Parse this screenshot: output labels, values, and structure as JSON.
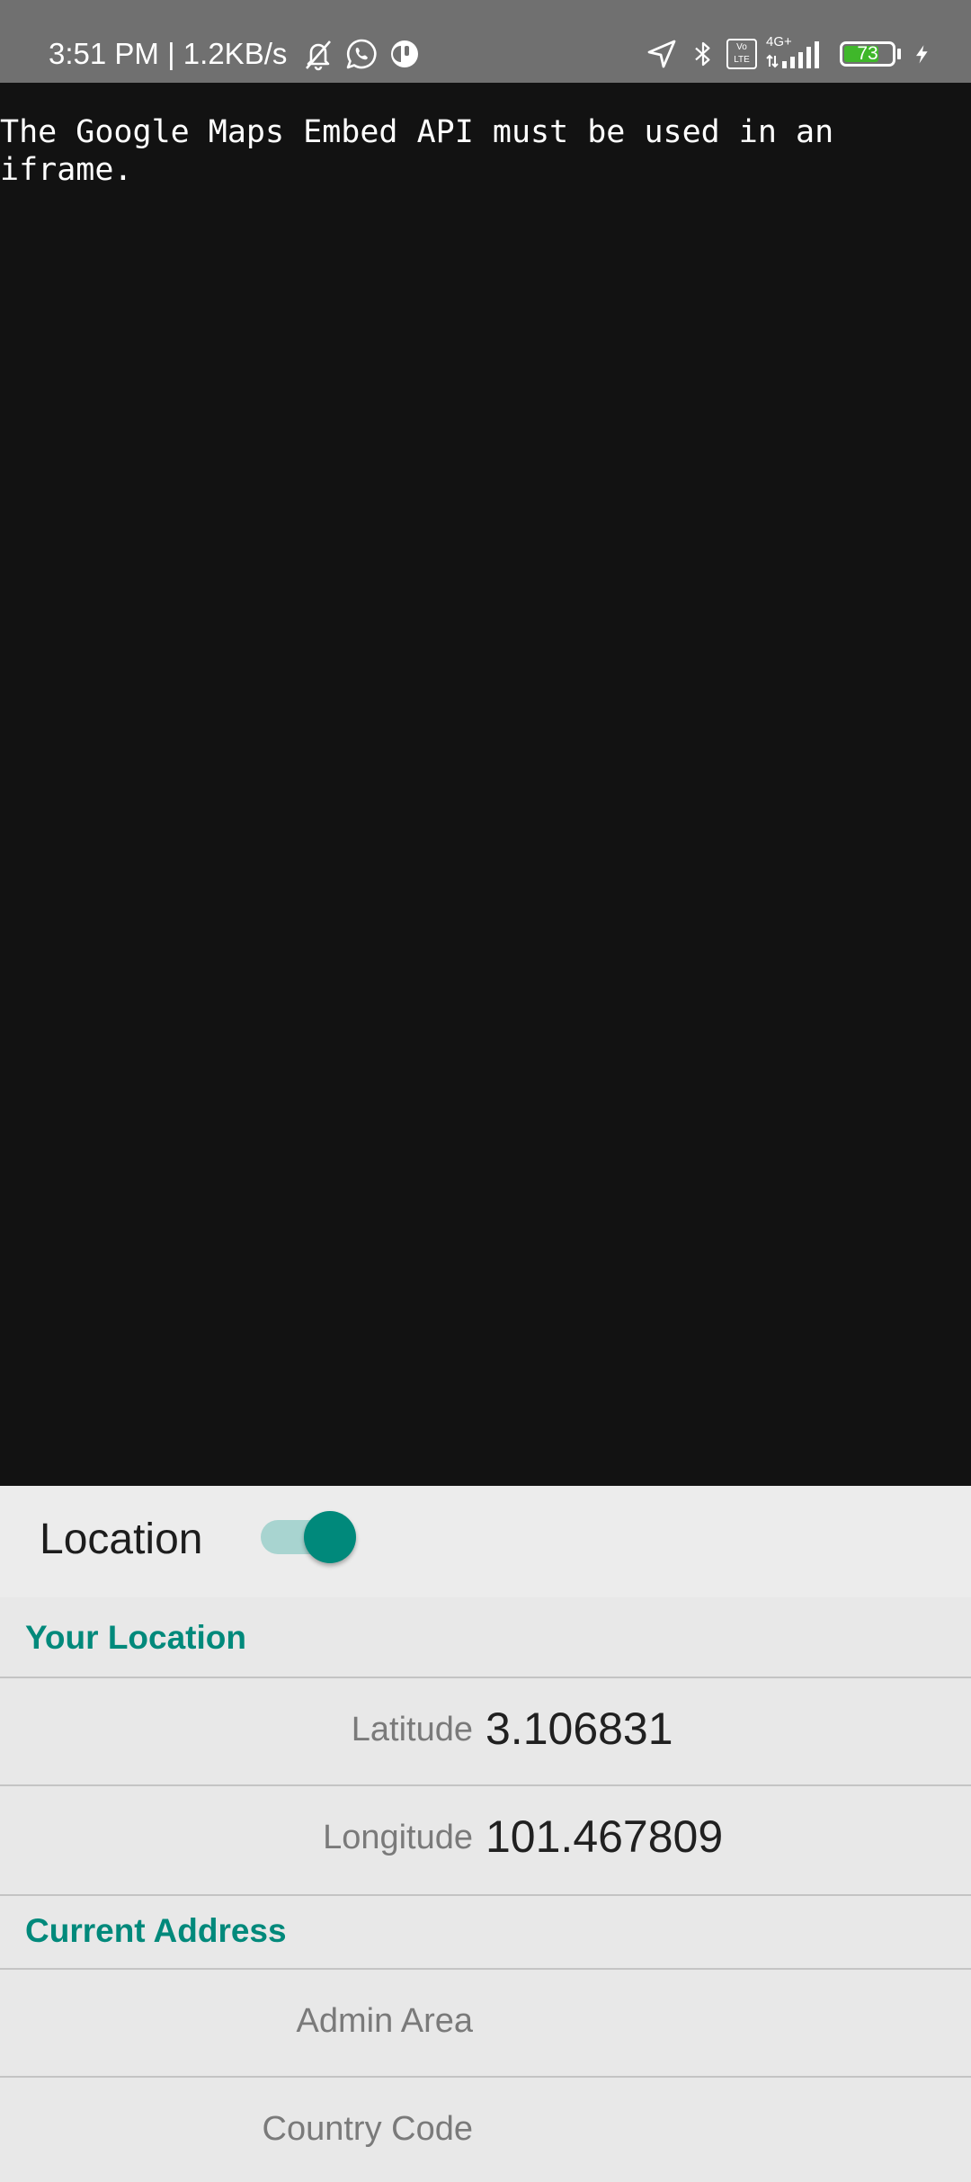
{
  "status_bar": {
    "time_speed": "3:51 PM | 1.2KB/s",
    "left_icons": [
      "mute-bell-icon",
      "whatsapp-icon",
      "app-notification-icon"
    ],
    "right_icons": [
      "location-arrow-icon",
      "bluetooth-icon",
      "volte-icon",
      "signal-4g-icon"
    ],
    "network_type": "4G+",
    "volte_label": "Vo LTE",
    "battery_level": "73",
    "battery_fraction": 0.73,
    "battery_color": "#3fb72a",
    "charging": true
  },
  "webview": {
    "message": "The Google Maps Embed API must be used in an\niframe.",
    "background": "#121212"
  },
  "location_toggle": {
    "label": "Location",
    "enabled": true,
    "accent": "#00897b"
  },
  "your_location": {
    "header": "Your Location",
    "rows": [
      {
        "label": "Latitude",
        "value": "3.106831"
      },
      {
        "label": "Longitude",
        "value": "101.467809"
      }
    ]
  },
  "current_address": {
    "header": "Current Address",
    "rows": [
      {
        "label": "Admin Area",
        "value": ""
      },
      {
        "label": "Country Code",
        "value": ""
      }
    ]
  }
}
